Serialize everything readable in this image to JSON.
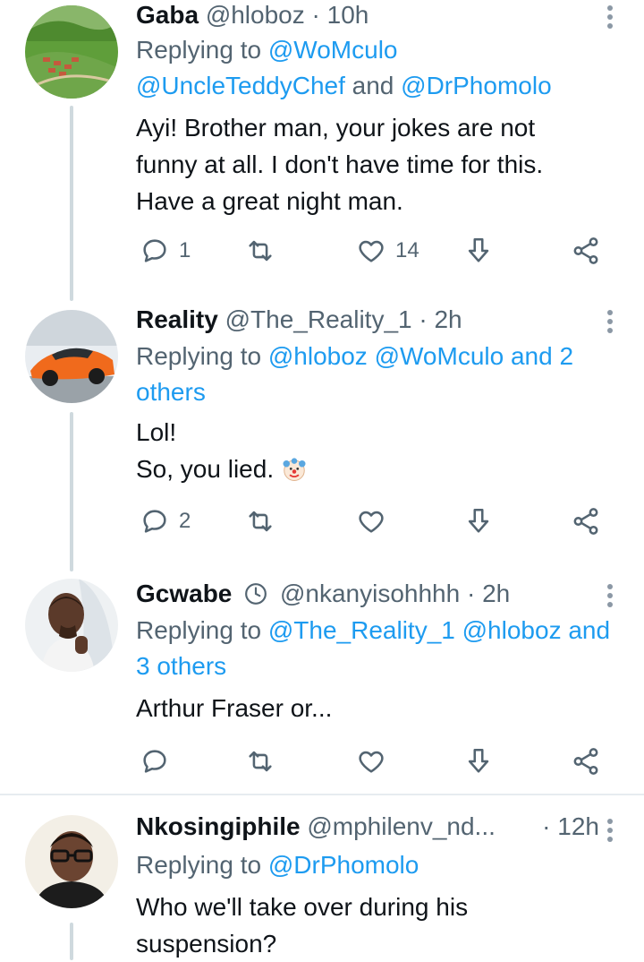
{
  "tweets": [
    {
      "name": "Gaba",
      "handle": "@hloboz",
      "time": "· 10h",
      "reply_prefix": "Replying to",
      "reply_line1_links": "@WoMculo",
      "reply_line2_links": "@UncleTeddyChef",
      "reply_line2_and": "and",
      "reply_line2_link2": "@DrPhomolo",
      "text_lines": [
        "Ayi! Brother man, your jokes are not",
        "funny at all. I don't have time for this.",
        "Have a great night man."
      ],
      "reply_count": "1",
      "like_count": "14"
    },
    {
      "name": "Reality",
      "handle": "@The_Reality_1",
      "time": "· 2h",
      "reply_prefix": "Replying to",
      "reply_line1_links": "@hloboz @WoMculo and 2",
      "reply_line2_links": "others",
      "text_lines": [
        "Lol!",
        "So, you lied."
      ],
      "emoji": "clown-face-icon",
      "reply_count": "2"
    },
    {
      "name": "Gcwabe",
      "handle": "@nkanyisohhhh",
      "time": "· 2h",
      "reply_prefix": "Replying to",
      "reply_line1_links": "@The_Reality_1 @hloboz and",
      "reply_line2_links": "3 others",
      "text_lines": [
        "Arthur Fraser or..."
      ]
    },
    {
      "name": "Nkosingiphile",
      "handle": "@mphilenv_nd...",
      "time": "· 12h",
      "reply_prefix": "Replying to",
      "reply_line1_links": "@DrPhomolo",
      "text_lines": [
        "Who we'll take over during his",
        "suspension?"
      ]
    }
  ],
  "colors": {
    "accent": "#1d9bf0",
    "muted": "#536471",
    "thread": "#cfd9de"
  }
}
